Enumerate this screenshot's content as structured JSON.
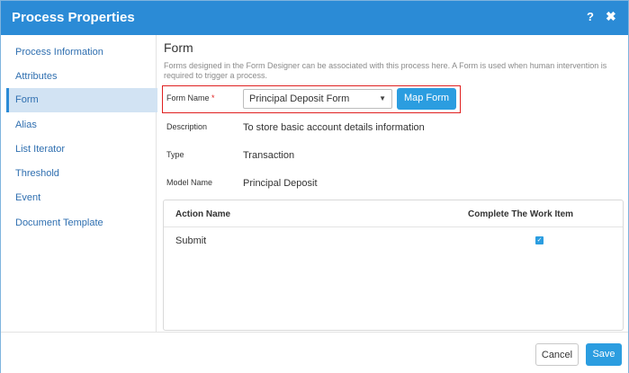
{
  "dialog": {
    "title": "Process Properties",
    "help_glyph": "?",
    "close_glyph": "✖"
  },
  "sidebar": {
    "items": [
      {
        "label": "Process Information"
      },
      {
        "label": "Attributes"
      },
      {
        "label": "Form",
        "active": true
      },
      {
        "label": "Alias"
      },
      {
        "label": "List Iterator"
      },
      {
        "label": "Threshold"
      },
      {
        "label": "Event"
      },
      {
        "label": "Document Template"
      }
    ]
  },
  "form": {
    "title": "Form",
    "description": "Forms designed in the Form Designer can be associated with this process here. A Form is used when human intervention is required to trigger a process.",
    "form_name_label": "Form Name",
    "required_marker": "*",
    "form_name_value": "Principal Deposit Form",
    "map_button": "Map Form",
    "description_label": "Description",
    "description_value": "To store basic account details information",
    "type_label": "Type",
    "type_value": "Transaction",
    "model_label": "Model Name",
    "model_value": "Principal Deposit"
  },
  "table": {
    "headers": [
      "Action Name",
      "Complete The Work Item"
    ],
    "rows": [
      {
        "action": "Submit",
        "complete": true
      }
    ]
  },
  "footer": {
    "cancel_label": "Cancel",
    "save_label": "Save"
  },
  "colors": {
    "header_blue": "#2b8bd6",
    "button_blue": "#2b9de0",
    "highlight_red": "#e02020",
    "active_nav_bg": "#d2e3f3"
  }
}
